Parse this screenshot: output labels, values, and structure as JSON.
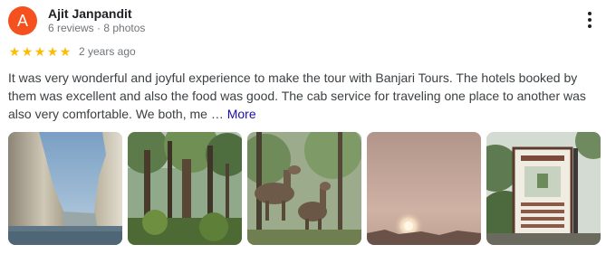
{
  "reviewer": {
    "initial": "A",
    "name": "Ajit Janpandit",
    "stats": "6 reviews · 8 photos",
    "avatar_color": "#f4511e"
  },
  "rating": {
    "stars": 5,
    "max_stars": 5,
    "star_color": "#fbbc04",
    "time": "2 years ago"
  },
  "review": {
    "text": "It was very wonderful and joyful experience to make the tour with Banjari Tours. The hotels booked by them was excellent and also the food was good. The cab service for traveling one place to another was also very comfortable. We both, me …",
    "more_label": "More"
  },
  "icons": {
    "menu": "more-vert-icon",
    "star": "star-icon"
  },
  "photos": [
    {
      "subject": "marble-rocks-gorge"
    },
    {
      "subject": "forest-trees"
    },
    {
      "subject": "deer-in-forest"
    },
    {
      "subject": "sunset-haze"
    },
    {
      "subject": "park-signboard"
    }
  ]
}
